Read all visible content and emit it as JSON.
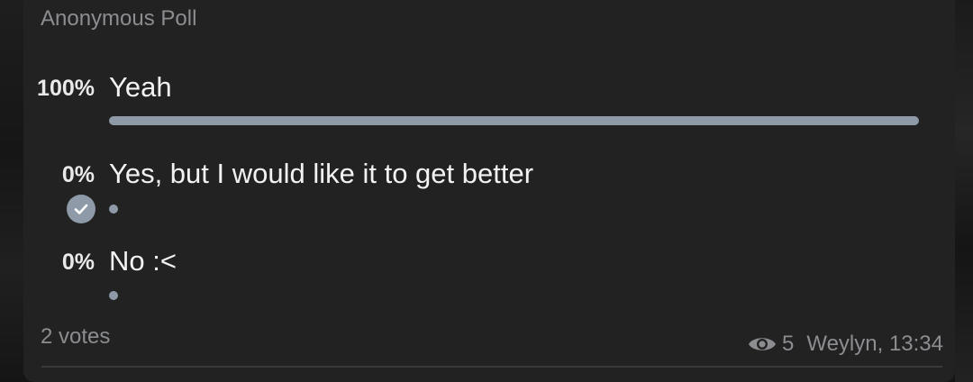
{
  "poll": {
    "type_label": "Anonymous Poll",
    "options": [
      {
        "percent_label": "100%",
        "text": "Yeah",
        "fraction": 1.0,
        "chosen": false
      },
      {
        "percent_label": "0%",
        "text": "Yes, but I would like it to get better",
        "fraction": 0.0,
        "chosen": true
      },
      {
        "percent_label": "0%",
        "text": "No :<",
        "fraction": 0.0,
        "chosen": false
      }
    ],
    "votes_label": "2 votes"
  },
  "message": {
    "views": "5",
    "author_time": "Weylyn, 13:34"
  },
  "colors": {
    "bubble": "#222222",
    "bar": "#8f9aa8",
    "muted_text": "#8b8d90"
  },
  "icons": {
    "chosen": "checkmark-circle-icon",
    "views": "eye-icon"
  }
}
